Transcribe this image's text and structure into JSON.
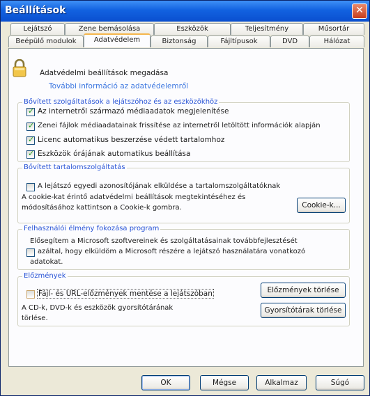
{
  "window": {
    "title": "Beállítások",
    "close_glyph": "✕"
  },
  "tabs_top": [
    "Lejátszó",
    "Zene bemásolása",
    "Eszközök",
    "Teljesítmény",
    "Műsortár"
  ],
  "tabs_bottom": [
    "Beépülő modulok",
    "Adatvédelem",
    "Biztonság",
    "Fájltípusok",
    "DVD",
    "Hálózat"
  ],
  "active_tab": "Adatvédelem",
  "header": {
    "text": "Adatvédelmi beállítások megadása",
    "link": "További információ az adatvédelemről"
  },
  "group1": {
    "title": "Bővített szolgáltatások a lejátszóhoz és az eszközökhöz",
    "items": [
      {
        "label": "Az internetről származó médiaadatok megjelenítése",
        "checked": true
      },
      {
        "label": "Zenei fájlok médiaadatainak frissítése az internetről letöltött információk alapján",
        "checked": true
      },
      {
        "label": "Licenc automatikus beszerzése védett tartalomhoz",
        "checked": true
      },
      {
        "label": "Eszközök órájának automatikus beállítása",
        "checked": true
      }
    ]
  },
  "group2": {
    "title": "Bővített tartalomszolgáltatás",
    "checkbox_label": "A lejátszó egyedi azonosítójának elküldése a tartalomszolgáltatóknak",
    "checked": false,
    "desc_line1": "A cookie-kat érintő adatvédelmi beállítások megtekintéséhez és",
    "desc_line2": "módosításához kattintson a Cookie-k gombra.",
    "button": "Cookie-k..."
  },
  "group3": {
    "title": "Felhasználói élmény fokozása program",
    "line1": "Elősegítem a Microsoft szoftvereinek és szolgáltatásainak továbbfejlesztését",
    "line2": "azáltal, hogy elküldöm a Microsoft részére a lejátszó használatára vonatkozó",
    "line3": "adatokat.",
    "checked": false
  },
  "group4": {
    "title": "Előzmények",
    "checkbox_label": "Fájl- és URL-előzmények mentése a lejátszóban",
    "checked": false,
    "desc_line1": "A CD-k, DVD-k és eszközök gyorsítótárának",
    "desc_line2": "törlése.",
    "btn_history": "Előzmények törlése",
    "btn_cache": "Gyorsítótárak törlése"
  },
  "footer": {
    "ok": "OK",
    "cancel": "Mégse",
    "apply": "Alkalmaz",
    "help": "Súgó"
  },
  "colors": {
    "titlebar": "#1262e0",
    "group_title": "#2a55d6",
    "link": "#3c77e0",
    "tab_highlight": "#f5b54a"
  }
}
